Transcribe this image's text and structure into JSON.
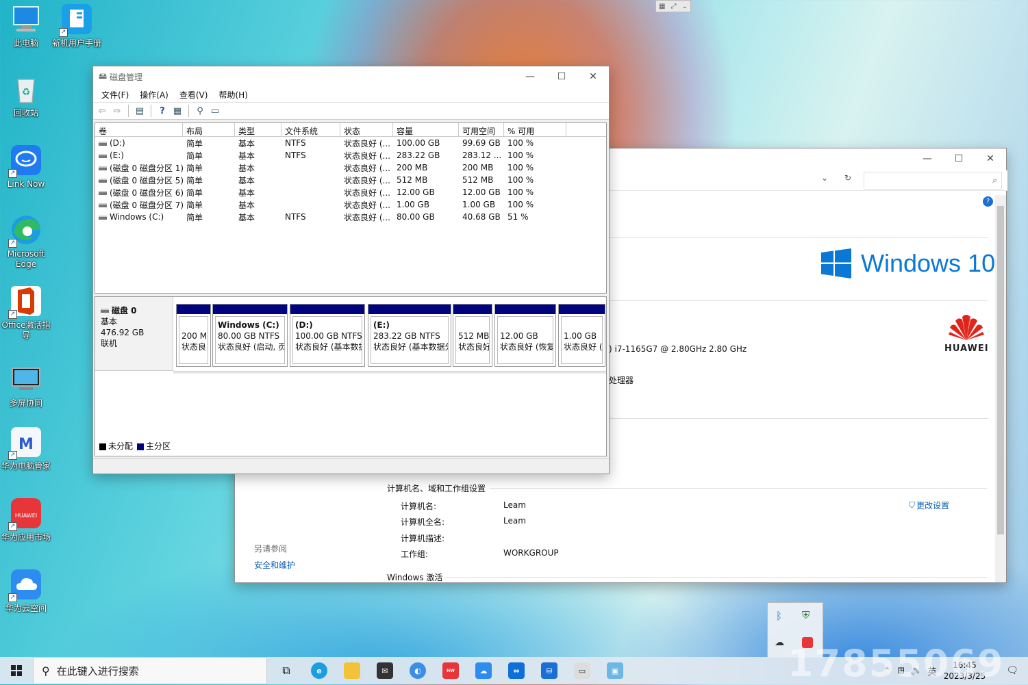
{
  "desktop": {
    "icons": [
      {
        "label": "此电脑"
      },
      {
        "label": "新机用户手册"
      },
      {
        "label": "回收站"
      },
      {
        "label": "Link Now"
      },
      {
        "label": "Microsoft Edge"
      },
      {
        "label": "Office激活指导"
      },
      {
        "label": "多屏协同"
      },
      {
        "label": "华为电脑管家"
      },
      {
        "label": "华为应用市场"
      },
      {
        "label": "华为云空间"
      }
    ]
  },
  "disk_mgmt": {
    "title": "磁盘管理",
    "menu": [
      "文件(F)",
      "操作(A)",
      "查看(V)",
      "帮助(H)"
    ],
    "columns": [
      "卷",
      "布局",
      "类型",
      "文件系统",
      "状态",
      "容量",
      "可用空间",
      "% 可用"
    ],
    "rows": [
      [
        "(D:)",
        "简单",
        "基本",
        "NTFS",
        "状态良好 (...",
        "100.00 GB",
        "99.69 GB",
        "100 %"
      ],
      [
        "(E:)",
        "简单",
        "基本",
        "NTFS",
        "状态良好 (...",
        "283.22 GB",
        "283.12 ...",
        "100 %"
      ],
      [
        "(磁盘 0 磁盘分区 1)",
        "简单",
        "基本",
        "",
        "状态良好 (...",
        "200 MB",
        "200 MB",
        "100 %"
      ],
      [
        "(磁盘 0 磁盘分区 5)",
        "简单",
        "基本",
        "",
        "状态良好 (...",
        "512 MB",
        "512 MB",
        "100 %"
      ],
      [
        "(磁盘 0 磁盘分区 6)",
        "简单",
        "基本",
        "",
        "状态良好 (...",
        "12.00 GB",
        "12.00 GB",
        "100 %"
      ],
      [
        "(磁盘 0 磁盘分区 7)",
        "简单",
        "基本",
        "",
        "状态良好 (...",
        "1.00 GB",
        "1.00 GB",
        "100 %"
      ],
      [
        "Windows (C:)",
        "简单",
        "基本",
        "NTFS",
        "状态良好 (...",
        "80.00 GB",
        "40.68 GB",
        "51 %"
      ]
    ],
    "disk": {
      "name": "磁盘 0",
      "type": "基本",
      "size": "476.92 GB",
      "status": "联机"
    },
    "partitions": [
      {
        "title": "",
        "line1": "200 M",
        "line2": "状态良"
      },
      {
        "title": "Windows  (C:)",
        "line1": "80.00 GB NTFS",
        "line2": "状态良好 (启动, 页"
      },
      {
        "title": "(D:)",
        "line1": "100.00 GB NTFS",
        "line2": "状态良好 (基本数据"
      },
      {
        "title": "(E:)",
        "line1": "283.22 GB NTFS",
        "line2": "状态良好 (基本数据分"
      },
      {
        "title": "",
        "line1": "512 MB",
        "line2": "状态良好"
      },
      {
        "title": "",
        "line1": "12.00 GB",
        "line2": "状态良好 (恢复"
      },
      {
        "title": "",
        "line1": "1.00 GB",
        "line2": "状态良好 ("
      }
    ],
    "legend": [
      {
        "label": "未分配",
        "color": "#000000"
      },
      {
        "label": "主分区",
        "color": "#02037e"
      }
    ]
  },
  "system": {
    "brand": "Windows 10",
    "oem": "HUAWEI",
    "processor_value": ") i7-1165G7 @ 2.80GHz   2.80 GHz",
    "system_type_value": "处理器",
    "section_title": "计算机名、域和工作组设置",
    "fields": [
      {
        "label": "计算机名:",
        "value": "Leam"
      },
      {
        "label": "计算机全名:",
        "value": "Leam"
      },
      {
        "label": "计算机描述:",
        "value": ""
      },
      {
        "label": "工作组:",
        "value": "WORKGROUP"
      }
    ],
    "change_settings": "更改设置",
    "see_also": "另请参阅",
    "security_link": "安全和维护",
    "activation": "Windows 激活"
  },
  "taskbar": {
    "search_placeholder": "在此键入进行搜索",
    "ime": "英",
    "time": "16:45",
    "date": "2023/3/25"
  },
  "overlay_text": "17855069"
}
